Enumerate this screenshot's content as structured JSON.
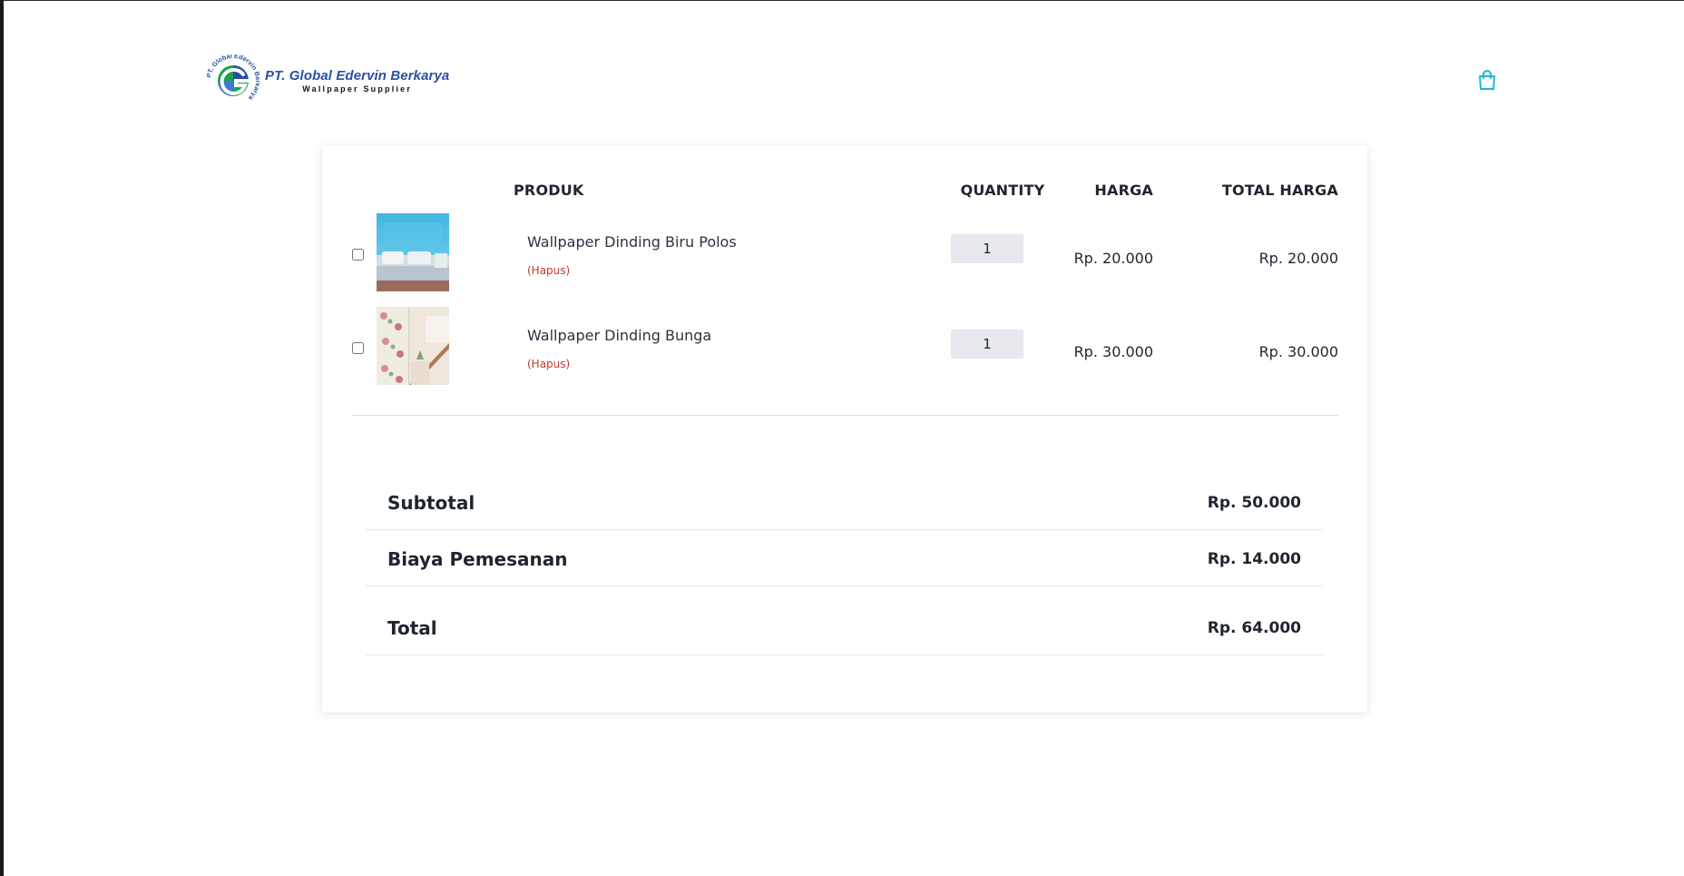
{
  "header": {
    "brand_name": "PT. Global Edervin Berkarya",
    "brand_tagline": "Wallpaper Supplier",
    "logo_ring_text": "PT. Global Edervin Berkarya",
    "cart_icon": "shopping-bag-icon"
  },
  "table": {
    "headers": {
      "product": "PRODUK",
      "quantity": "QUANTITY",
      "price": "HARGA",
      "total_price": "TOTAL HARGA"
    },
    "rows": [
      {
        "name": "Wallpaper Dinding Biru Polos",
        "remove_label": "(Hapus)",
        "quantity": "1",
        "price": "Rp. 20.000",
        "total": "Rp. 20.000",
        "checked": false
      },
      {
        "name": "Wallpaper Dinding Bunga",
        "remove_label": "(Hapus)",
        "quantity": "1",
        "price": "Rp. 30.000",
        "total": "Rp. 30.000",
        "checked": false
      }
    ]
  },
  "summary": {
    "subtotal_label": "Subtotal",
    "subtotal_value": "Rp. 50.000",
    "fee_label": "Biaya Pemesanan",
    "fee_value": "Rp. 14.000",
    "total_label": "Total",
    "total_value": "Rp. 64.000"
  },
  "colors": {
    "brand_blue": "#2a4fa8",
    "cart_accent": "#1fb6d6",
    "remove_red": "#c0392b",
    "qty_bg": "#e6e8ee"
  }
}
